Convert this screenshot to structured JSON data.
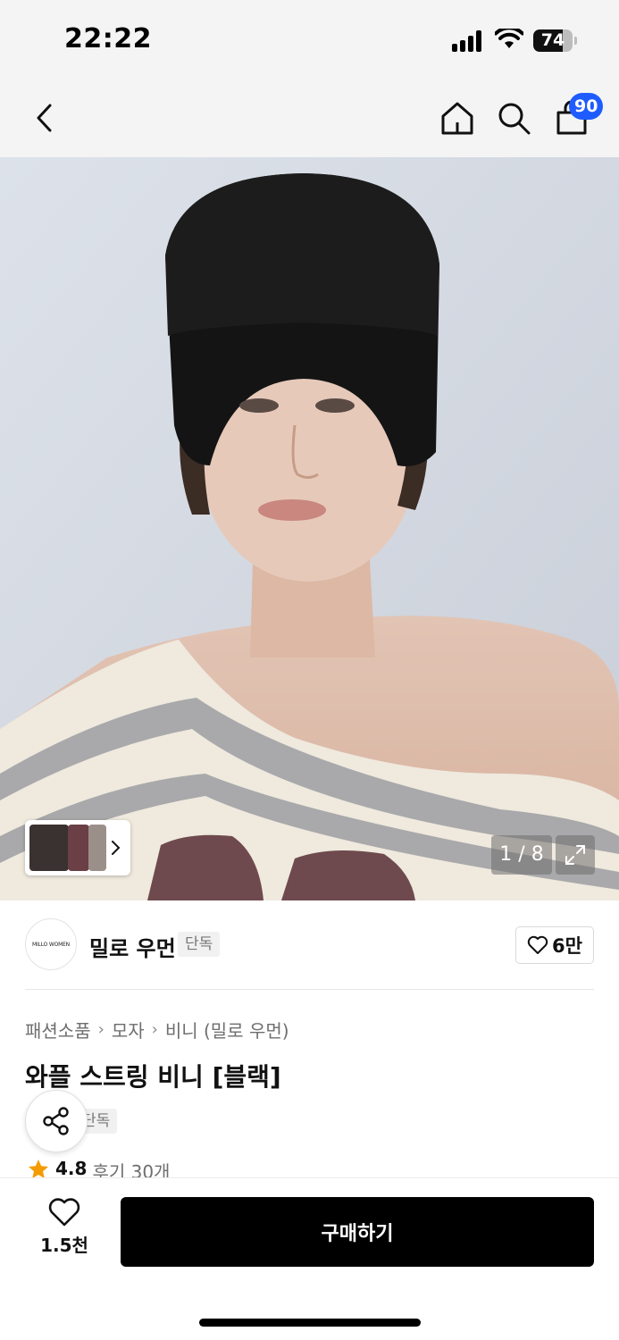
{
  "status_bar": {
    "time": "22:22",
    "battery": "74",
    "battery_level": 0.74
  },
  "nav": {
    "back_icon": "chevron-left-icon",
    "home_icon": "home-icon",
    "search_icon": "search-icon",
    "cart_icon": "shopping-bag-icon",
    "cart_badge": "90",
    "badge_color": "#1f5cff"
  },
  "gallery": {
    "counter": "1 / 8",
    "expand_icon": "expand-icon"
  },
  "brand": {
    "logo_text": "MILLO WOMEN",
    "name": "밀로 우먼",
    "exclusive_tag": "단독",
    "likes": "6만"
  },
  "breadcrumb": [
    "패션소품",
    "모자",
    "비니 (밀로 우먼)"
  ],
  "product": {
    "title": "와플 스트링 비니 [블랙]",
    "exclusive_tag": "단독",
    "rating": "4.8",
    "reviews": "후기 30개"
  },
  "bottom_bar": {
    "wish_count": "1.5천",
    "buy_label": "구매하기"
  }
}
